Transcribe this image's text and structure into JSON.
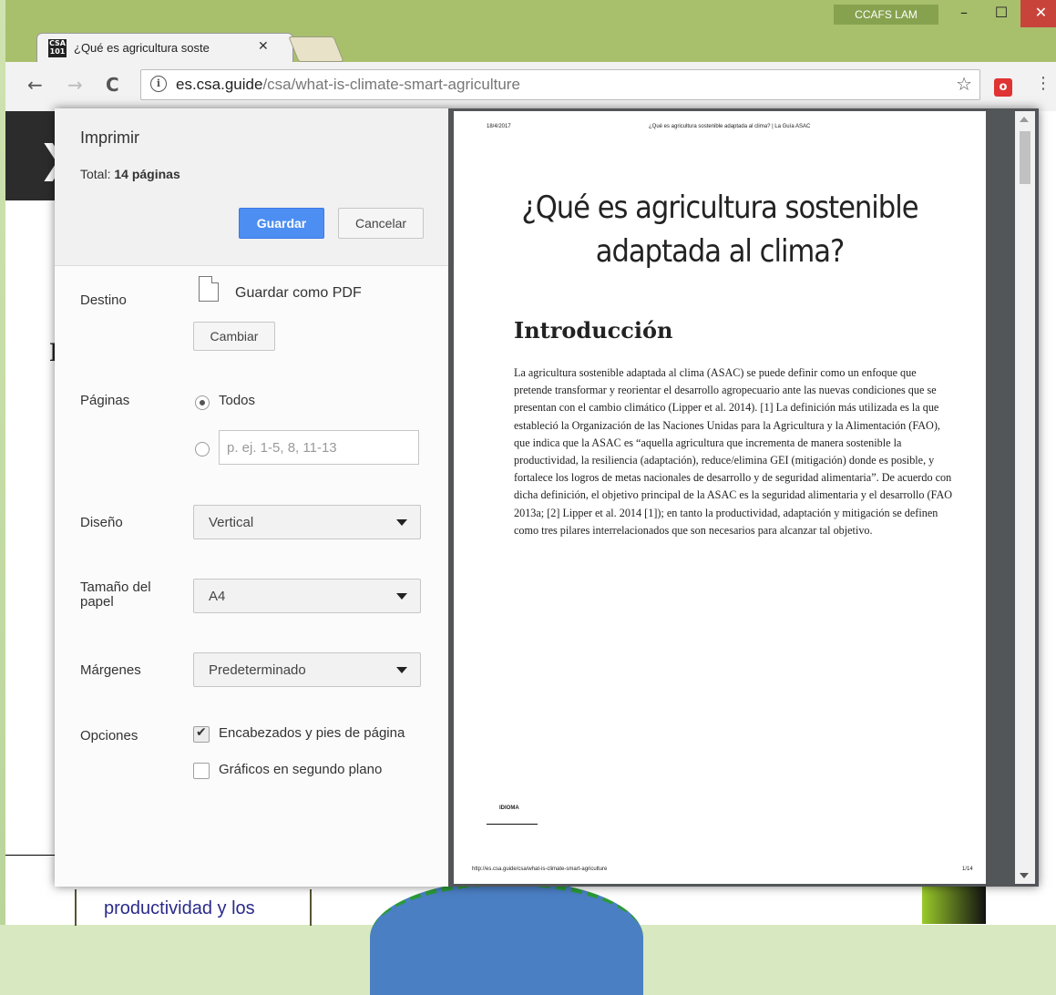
{
  "window": {
    "profile": "CCAFS LAM",
    "minimize": "–",
    "maximize": "☐",
    "close": "✕"
  },
  "tab": {
    "favicon": "CSA 101",
    "title": "¿Qué es agricultura soste",
    "close": "✕"
  },
  "toolbar": {
    "back": "←",
    "forward": "→",
    "reload": "C",
    "url_host": "es.csa.guide",
    "url_path": "/csa/what-is-climate-smart-agriculture",
    "star": "☆",
    "menu": "⋮",
    "ext_label": "o"
  },
  "background_page": {
    "heading_fragment": "I",
    "box_text": "productividad y los"
  },
  "print": {
    "title": "Imprimir",
    "total_label": "Total:",
    "total_value": "14 páginas",
    "save": "Guardar",
    "cancel": "Cancelar",
    "destination_label": "Destino",
    "destination_value": "Guardar como PDF",
    "change": "Cambiar",
    "pages_label": "Páginas",
    "pages_all": "Todos",
    "pages_placeholder": "p. ej. 1-5, 8, 11-13",
    "layout_label": "Diseño",
    "layout_value": "Vertical",
    "paper_label": "Tamaño del papel",
    "paper_value": "A4",
    "margins_label": "Márgenes",
    "margins_value": "Predeterminado",
    "options_label": "Opciones",
    "opt_headers": "Encabezados y pies de página",
    "opt_headers_checked": true,
    "opt_bg": "Gráficos en segundo plano",
    "opt_bg_checked": false
  },
  "preview": {
    "date": "18/4/2017",
    "header_title": "¿Qué es agricultura sostenible adaptada al clima? | La Guía ASAC",
    "title": "¿Qué es agricultura sostenible adaptada al clima?",
    "heading": "Introducción",
    "body": "La agricultura sostenible adaptada al clima (ASAC) se puede definir como un enfoque que pretende transformar y reorientar el desarrollo agropecuario ante las nuevas condiciones que se presentan con el cambio climático (Lipper et al. 2014). [1] La definición más utilizada es la que estableció la Organización de las Naciones Unidas para la Agricultura y la Alimentación (FAO), que indica que la ASAC es “aquella agricultura que incrementa de manera sostenible la productividad, la resiliencia (adaptación), reduce/elimina GEI (mitigación) donde es posible, y fortalece los logros de metas nacionales de desarrollo y de seguridad alimentaria”. De acuerdo con dicha definición, el objetivo principal de la ASAC es la seguridad alimentaria y el desarrollo (FAO 2013a; [2] Lipper et al. 2014 [1]); en tanto la productividad, adaptación y mitigación se definen como tres pilares interrelacionados que son necesarios para alcanzar tal objetivo.",
    "logo": "IDIOMA",
    "footer_url": "http://es.csa.guide/csa/what-is-climate-smart-agriculture",
    "page_num": "1/14"
  }
}
